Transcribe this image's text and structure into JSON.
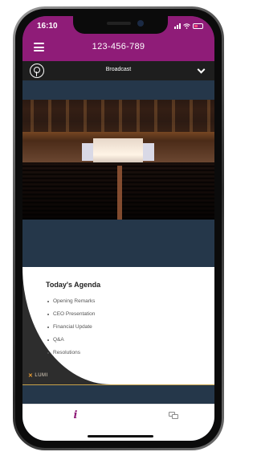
{
  "status_bar": {
    "time": "16:10",
    "battery_color": "#ff4a7b"
  },
  "header": {
    "meeting_id": "123-456-789",
    "background": "#8f1c78"
  },
  "broadcast_bar": {
    "title": "Broadcast"
  },
  "agenda": {
    "title": "Today's Agenda",
    "items": [
      "Opening Remarks",
      "CEO Presentation",
      "Financial Update",
      "Q&A",
      "Resolutions"
    ]
  },
  "branding": {
    "logo_text": "LUMI"
  },
  "tabs": {
    "info_icon": "info-icon",
    "messages_icon": "chat-icon",
    "info_glyph": "i"
  }
}
